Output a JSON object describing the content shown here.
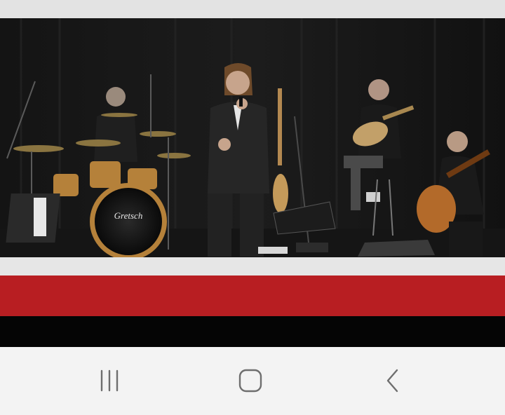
{
  "video": {
    "scene": "jazz-quartet-stage-performance",
    "drum_brand": "Gretsch"
  },
  "colors": {
    "red_band": "#b81e22",
    "black_band": "#050505",
    "nav_background": "#f3f3f3",
    "nav_icon": "#6e6e6e"
  },
  "nav": {
    "recent_icon": "recent-apps-icon",
    "home_icon": "home-icon",
    "back_icon": "back-icon"
  }
}
